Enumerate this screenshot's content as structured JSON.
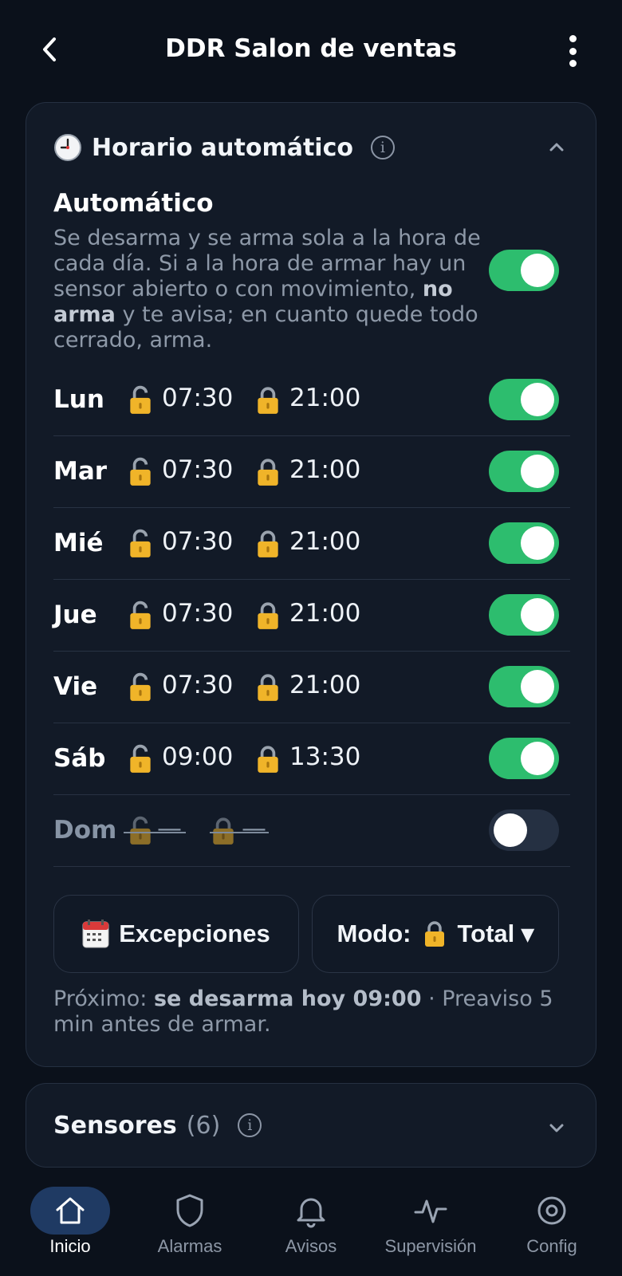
{
  "header": {
    "title": "DDR Salon de ventas"
  },
  "schedule": {
    "title": "Horario automático",
    "info_glyph": "i",
    "expanded": true,
    "auto": {
      "title": "Automático",
      "desc_part1": "Se desarma y se arma sola a la hora de cada día. Si a la hora de armar hay un sensor abierto o con movimiento, ",
      "desc_bold": "no arma",
      "desc_part2": " y te avisa; en cuanto quede todo cerrado, arma.",
      "enabled": true
    },
    "days": [
      {
        "name": "Lun",
        "disarm": "07:30",
        "arm": "21:00",
        "enabled": true
      },
      {
        "name": "Mar",
        "disarm": "07:30",
        "arm": "21:00",
        "enabled": true
      },
      {
        "name": "Mié",
        "disarm": "07:30",
        "arm": "21:00",
        "enabled": true
      },
      {
        "name": "Jue",
        "disarm": "07:30",
        "arm": "21:00",
        "enabled": true
      },
      {
        "name": "Vie",
        "disarm": "07:30",
        "arm": "21:00",
        "enabled": true
      },
      {
        "name": "Sáb",
        "disarm": "09:00",
        "arm": "13:30",
        "enabled": true
      },
      {
        "name": "Dom",
        "disarm": "—",
        "arm": "—",
        "enabled": false
      }
    ],
    "exceptions_label": "Excepciones",
    "mode_prefix": "Modo:",
    "mode_value": "Total ▾",
    "next_prefix": "Próximo: ",
    "next_bold": "se desarma hoy 09:00",
    "next_suffix": " · Preaviso 5 min antes de armar."
  },
  "sensors": {
    "title": "Sensores",
    "count": "(6)",
    "info_glyph": "i",
    "expanded": false
  },
  "nav": {
    "items": [
      {
        "label": "Inicio",
        "icon": "home-icon",
        "active": true
      },
      {
        "label": "Alarmas",
        "icon": "shield-icon",
        "active": false
      },
      {
        "label": "Avisos",
        "icon": "bell-icon",
        "active": false
      },
      {
        "label": "Supervisión",
        "icon": "pulse-icon",
        "active": false
      },
      {
        "label": "Config",
        "icon": "settings-icon",
        "active": false
      }
    ]
  },
  "colors": {
    "toggle_on": "#2dbd6e",
    "toggle_off": "#253042",
    "nav_active": "#1f3a63",
    "lock_gold": "#f0b429"
  }
}
